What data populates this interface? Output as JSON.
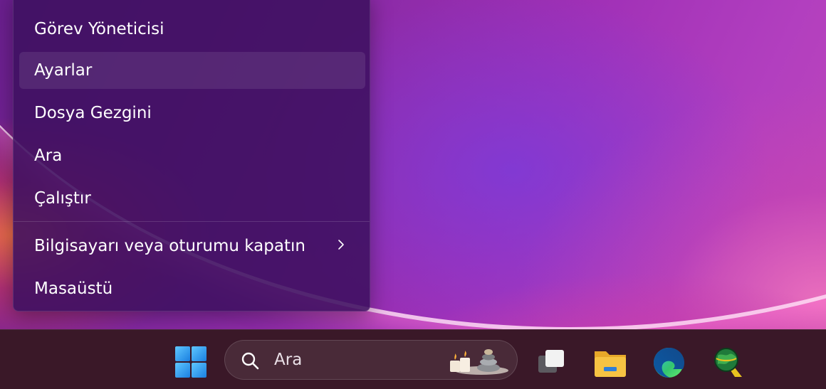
{
  "context_menu": {
    "items": [
      {
        "label": "Görev Yöneticisi"
      },
      {
        "label": "Ayarlar"
      },
      {
        "label": "Dosya Gezgini"
      },
      {
        "label": "Ara"
      },
      {
        "label": "Çalıştır"
      },
      {
        "label": "Bilgisayarı veya oturumu kapatın",
        "icon": "chevron-right-icon"
      },
      {
        "label": "Masaüstü"
      }
    ],
    "hovered_item": "Ayarlar"
  },
  "taskbar": {
    "start_icon": "windows-logo-icon",
    "search": {
      "icon": "search-icon",
      "placeholder": "Ara",
      "highlight_image": "candles-stones-icon"
    },
    "apps": [
      {
        "icon": "task-view-icon"
      },
      {
        "icon": "file-explorer-icon"
      },
      {
        "icon": "edge-icon"
      },
      {
        "icon": "globe-app-icon"
      }
    ]
  },
  "colors": {
    "menu_background": "#3e1060",
    "taskbar_background": "#3a1828",
    "windows_blue": "#1e90e8",
    "folder_yellow": "#f6c343"
  }
}
